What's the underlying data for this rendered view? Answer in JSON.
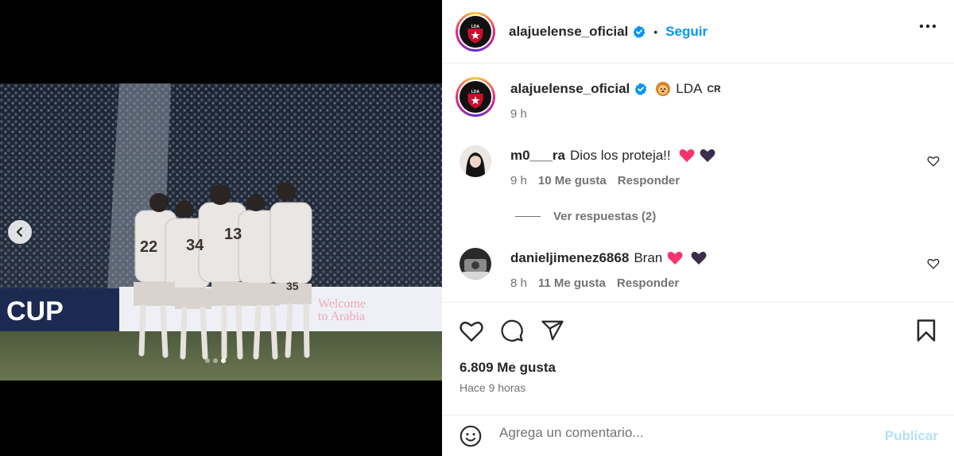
{
  "post": {
    "account": "alajuelense_oficial",
    "follow_label": "Seguir",
    "separator": "•",
    "caption_text": "LDA",
    "caption_suffix": "CR",
    "caption_time": "9 h",
    "likes": "6.809 Me gusta",
    "posted_ago": "Hace 9 horas",
    "carousel": {
      "total_slides": 3,
      "active_slide": 3
    }
  },
  "comments": [
    {
      "user": "m0___ra",
      "text": "Dios los proteja!!",
      "time": "9 h",
      "likes": "10 Me gusta",
      "reply_label": "Responder",
      "view_replies": "Ver respuestas (2)"
    },
    {
      "user": "danieljimenez6868",
      "text": "Bran",
      "time": "8 h",
      "likes": "11 Me gusta",
      "reply_label": "Responder"
    }
  ],
  "composer": {
    "placeholder": "Agrega un comentario...",
    "publish_label": "Publicar"
  },
  "photo_text": {
    "banner_left": "CUP",
    "banner_right_1": "Welcome",
    "banner_right_2": "to Arabia"
  },
  "colors": {
    "accent_blue": "#0095f6",
    "publish_disabled": "#b2dffc",
    "club_red": "#c8102e"
  },
  "icons": {
    "prev": "chevron-left-icon",
    "more": "more-options-icon",
    "verified": "verified-badge-icon",
    "like": "heart-icon",
    "comment": "comment-icon",
    "share": "share-icon",
    "save": "bookmark-icon",
    "emoji": "emoji-icon"
  }
}
